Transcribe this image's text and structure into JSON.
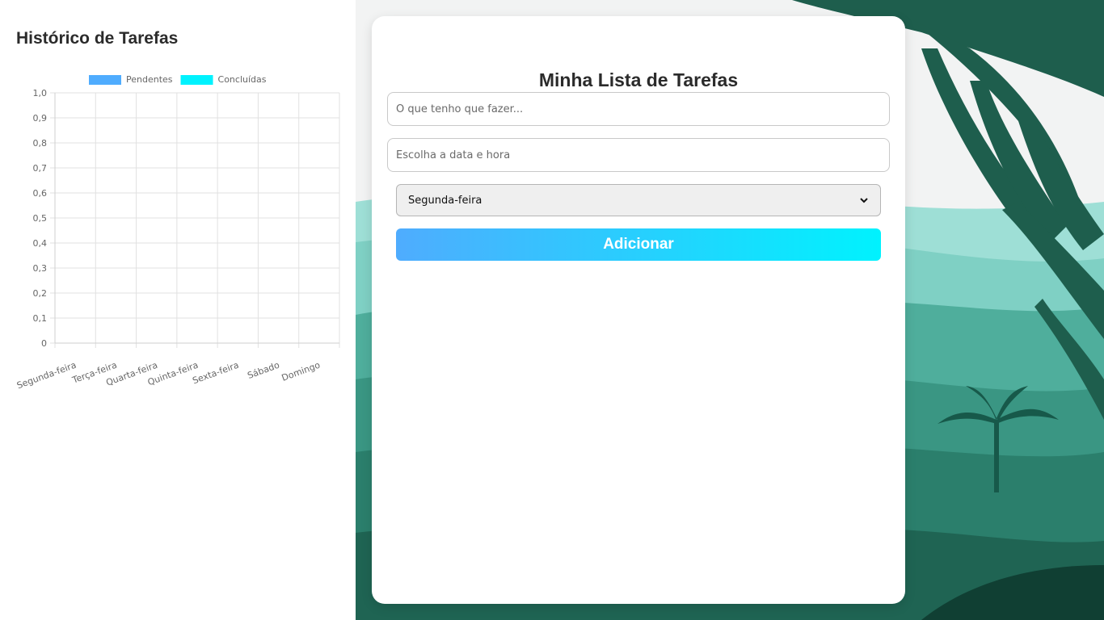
{
  "sidebar": {
    "title": "Histórico de Tarefas"
  },
  "chart_data": {
    "type": "bar",
    "categories": [
      "Segunda-feira",
      "Terça-feira",
      "Quarta-feira",
      "Quinta-feira",
      "Sexta-feira",
      "Sábado",
      "Domingo"
    ],
    "series": [
      {
        "name": "Pendentes",
        "values": [
          0,
          0,
          0,
          0,
          0,
          0,
          0
        ],
        "color": "#4facfe"
      },
      {
        "name": "Concluídas",
        "values": [
          0,
          0,
          0,
          0,
          0,
          0,
          0
        ],
        "color": "#00f2fe"
      }
    ],
    "yticks": [
      "0",
      "0,1",
      "0,2",
      "0,3",
      "0,4",
      "0,5",
      "0,6",
      "0,7",
      "0,8",
      "0,9",
      "1,0"
    ],
    "ylim": [
      0,
      1
    ],
    "grid": true,
    "legend": "top"
  },
  "main": {
    "title": "Minha Lista de Tarefas",
    "task_placeholder": "O que tenho que fazer...",
    "date_placeholder": "Escolha a data e hora",
    "day_select": "Segunda-feira",
    "add_label": "Adicionar"
  },
  "colors": {
    "accent_start": "#4facfe",
    "accent_end": "#00f2fe",
    "forest_dark": "#1e5a4a",
    "forest_light": "#8fdad0"
  }
}
